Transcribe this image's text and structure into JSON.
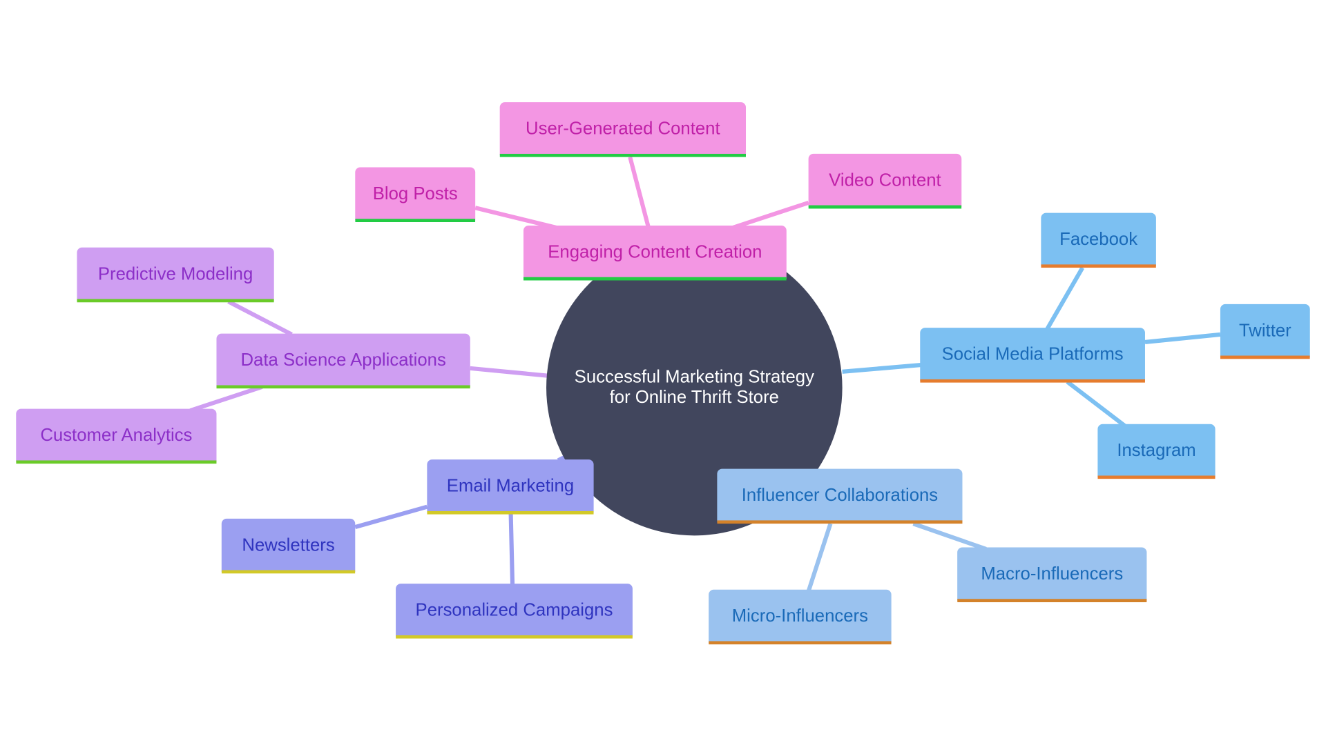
{
  "diagram": {
    "type": "mindmap",
    "root": {
      "id": "root",
      "label_line1": "Successful Marketing Strategy",
      "label_line2": "for Online Thrift Store",
      "color": "#41465d"
    },
    "branches": [
      {
        "id": "content",
        "label": "Engaging Content Creation",
        "theme": "pink",
        "line_color": "#f396e3",
        "children": [
          {
            "id": "ugc",
            "label": "User-Generated Content"
          },
          {
            "id": "blog",
            "label": "Blog Posts"
          },
          {
            "id": "video",
            "label": "Video Content"
          }
        ]
      },
      {
        "id": "social",
        "label": "Social Media Platforms",
        "theme": "sky",
        "line_color": "#7cc0f2",
        "children": [
          {
            "id": "facebook",
            "label": "Facebook"
          },
          {
            "id": "twitter",
            "label": "Twitter"
          },
          {
            "id": "instagram",
            "label": "Instagram"
          }
        ]
      },
      {
        "id": "influencer",
        "label": "Influencer Collaborations",
        "theme": "light",
        "line_color": "#9ac2ef",
        "children": [
          {
            "id": "macro",
            "label": "Macro-Influencers"
          },
          {
            "id": "micro",
            "label": "Micro-Influencers"
          }
        ]
      },
      {
        "id": "email",
        "label": "Email Marketing",
        "theme": "indigo",
        "line_color": "#9b9ff1",
        "children": [
          {
            "id": "newsletters",
            "label": "Newsletters"
          },
          {
            "id": "personalized",
            "label": "Personalized Campaigns"
          }
        ]
      },
      {
        "id": "datasci",
        "label": "Data Science Applications",
        "theme": "violet",
        "line_color": "#cf9ef2",
        "children": [
          {
            "id": "predictive",
            "label": "Predictive Modeling"
          },
          {
            "id": "customer",
            "label": "Customer Analytics"
          }
        ]
      }
    ]
  }
}
